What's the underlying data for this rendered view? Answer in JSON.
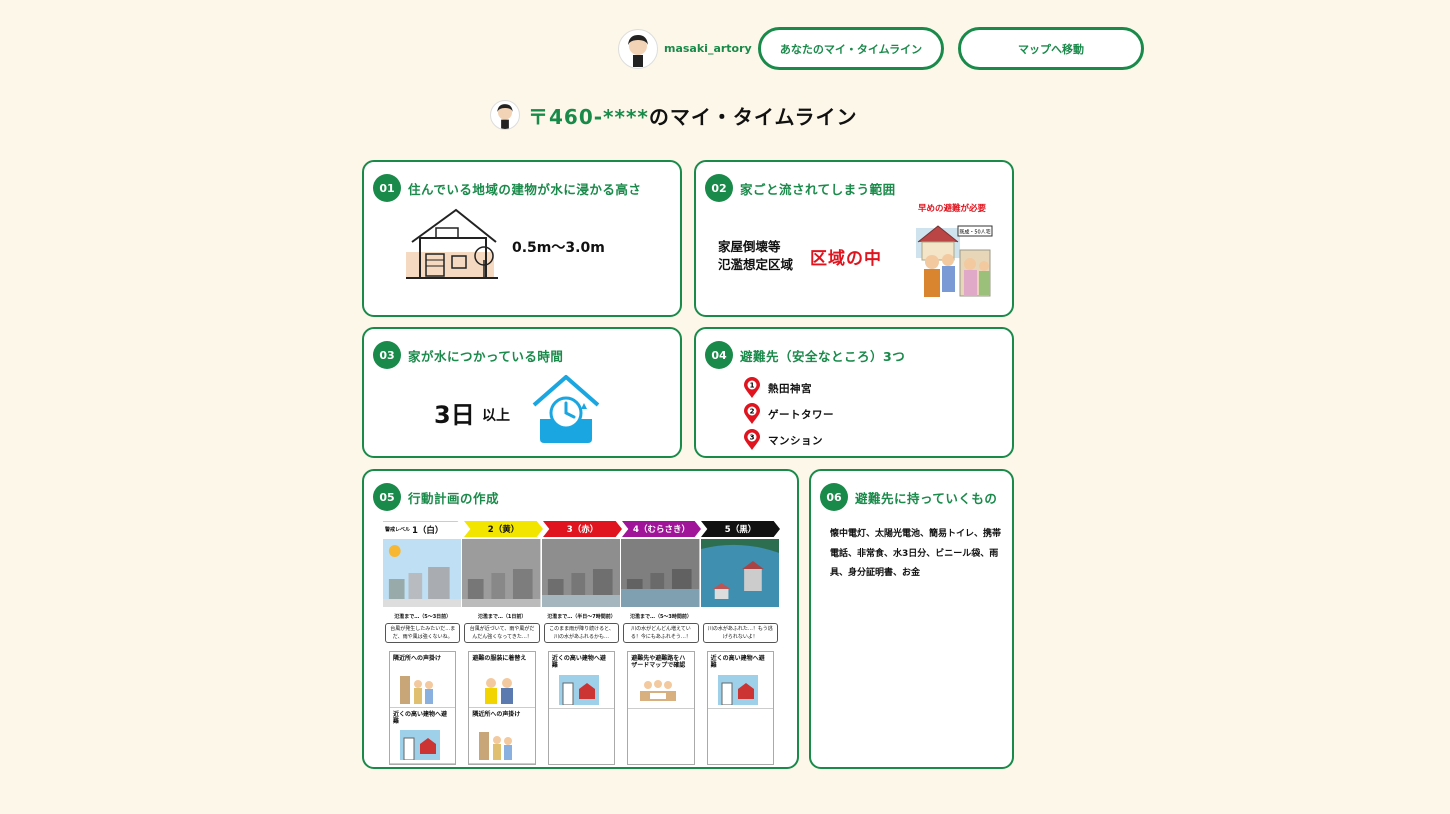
{
  "header": {
    "username": "masaki_artory",
    "my_timeline_button": "あなたのマイ・タイムライン",
    "map_button": "マップへ移動"
  },
  "page": {
    "zip": "〒460-****",
    "title_suffix": "のマイ・タイムライン"
  },
  "cards": {
    "c1": {
      "num": "01",
      "title": "住んでいる地域の建物が水に浸かる高さ",
      "value": "0.5m〜3.0m"
    },
    "c2": {
      "num": "02",
      "title": "家ごと流されてしまう範囲",
      "label_line1": "家屋倒壊等",
      "label_line2": "氾濫想定区域",
      "value": "区域の中",
      "note": "早めの避難が必要",
      "sign": "既成・50人宅"
    },
    "c3": {
      "num": "03",
      "title": "家が水につかっている時間",
      "value": "3日",
      "unit": "以上"
    },
    "c4": {
      "num": "04",
      "title": "避難先（安全なところ）3つ",
      "shelters": [
        {
          "n": "1",
          "name": "熱田神宮"
        },
        {
          "n": "2",
          "name": "ゲートタワー"
        },
        {
          "n": "3",
          "name": "マンション"
        }
      ]
    },
    "c5": {
      "num": "05",
      "title": "行動計画の作成",
      "level_prefix": "警戒レベル",
      "levels": [
        "1（白）",
        "2（黄）",
        "3（赤）",
        "4（むらさき）",
        "5（黒）"
      ],
      "whens": [
        "氾濫まで…（5〜3日前）",
        "氾濫まで…（1日前）",
        "氾濫まで…（半日〜7時間前）",
        "氾濫まで…（5〜3時間前）",
        ""
      ],
      "bubbles": [
        "台風が発生したみたいだ…まだ、雨や風は強くないね。",
        "台風が近づいて、雨や風がだんだん強くなってきた…！",
        "このまま雨が降り続けると、川の水があふれるかも…",
        "川の水がどんどん増えている！今にもあふれそう…！",
        "川の水があふれた…！もう逃げられないよ！"
      ],
      "actions": [
        [
          "隣近所への声掛け",
          "近くの高い建物へ避難"
        ],
        [
          "避難の服装に着替え",
          "隣近所への声掛け"
        ],
        [
          "近くの高い建物へ避難"
        ],
        [
          "避難先や避難路をハザードマップで確認"
        ],
        [
          "近くの高い建物へ避難"
        ]
      ],
      "colors": {
        "l1": "#ffffff",
        "l2": "#f2e600",
        "l3": "#e0141e",
        "l4": "#a0149a",
        "l5": "#111111"
      }
    },
    "c6": {
      "num": "06",
      "title": "避難先に持っていくもの",
      "items": "懐中電灯、太陽光電池、簡易トイレ、携帯電話、非常食、水3日分、ビニール袋、雨具、身分証明書、お金"
    }
  },
  "icons": [
    "avatar",
    "house-icon",
    "tree-icon",
    "evacuation-illustration",
    "clock-house-icon",
    "map-pin-icon"
  ],
  "accent": "#1a8a4a",
  "danger": "#e0141e"
}
